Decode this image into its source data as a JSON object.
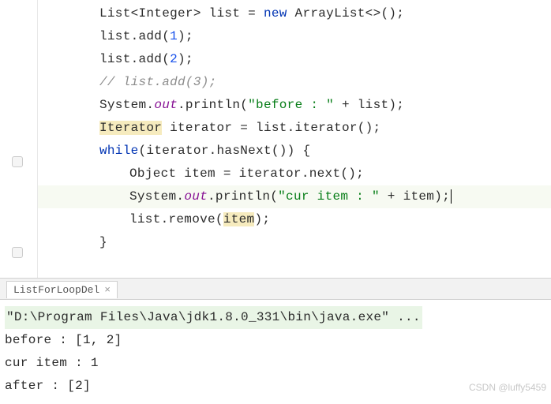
{
  "code": {
    "l1a": "List<Integer> list = ",
    "l1_kw": "new",
    "l1b": " ArrayList<>();",
    "l2a": "list.add(",
    "l2_num": "1",
    "l2b": ");",
    "l3a": "list.add(",
    "l3_num": "2",
    "l3b": ");",
    "l4": "// list.add(3);",
    "l5a": "System.",
    "l5_out": "out",
    "l5b": ".println(",
    "l5_str": "\"before : \"",
    "l5c": " + list);",
    "l6_iter": "Iterator",
    "l6b": " iterator = list.iterator();",
    "l7_kw": "while",
    "l7b": "(iterator.hasNext()) {",
    "l8": "Object item = iterator.next();",
    "l9a": "System.",
    "l9_out": "out",
    "l9b": ".println(",
    "l9_str": "\"cur item : \"",
    "l9c": " + item);",
    "l10a": "list.remove(",
    "l10_item": "item",
    "l10b": ");",
    "l11": "}"
  },
  "tab": {
    "name": "ListForLoopDel",
    "close": "×"
  },
  "console": {
    "cmd": "\"D:\\Program Files\\Java\\jdk1.8.0_331\\bin\\java.exe\" ...",
    "out1": "before : [1, 2]",
    "out2": "cur item : 1",
    "out3": "after : [2]"
  },
  "watermark": "CSDN @luffy5459"
}
